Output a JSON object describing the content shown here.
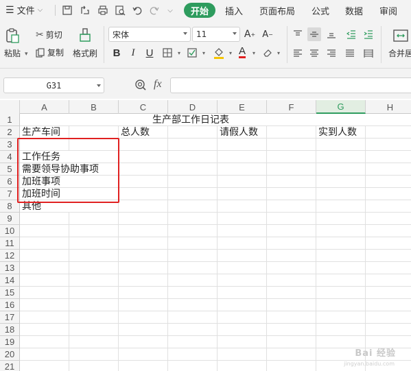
{
  "menubar": {
    "file_label": "文件",
    "tabs": [
      "开始",
      "插入",
      "页面布局",
      "公式",
      "数据",
      "审阅"
    ],
    "active_tab": "开始"
  },
  "ribbon": {
    "paste_label": "粘贴",
    "cut_label": "剪切",
    "copy_label": "复制",
    "format_painter_label": "格式刷",
    "font_name": "宋体",
    "font_size": "11",
    "merge_label": "合并居"
  },
  "formula_bar": {
    "name_box": "G31",
    "fx_label": "fx",
    "formula": ""
  },
  "grid": {
    "columns": [
      "A",
      "B",
      "C",
      "D",
      "E",
      "F",
      "G",
      "H"
    ],
    "selected_column": "G",
    "rows": [
      "1",
      "2",
      "3",
      "4",
      "5",
      "6",
      "7",
      "8",
      "9",
      "10",
      "11",
      "12",
      "13",
      "14",
      "15",
      "16",
      "17",
      "18",
      "19",
      "20",
      "21"
    ],
    "cells": {
      "title": "生产部工作日记表",
      "a2": "生产车间",
      "c2": "总人数",
      "e2": "请假人数",
      "g2": "实到人数",
      "a3": "工作任务",
      "a4": "需要领导协助事项",
      "a5": "加班事项",
      "a6": "加班时间",
      "a7": "其他"
    }
  },
  "watermark": {
    "text": "Bai 经验",
    "sub": "jingyan.baidu.com"
  },
  "colors": {
    "accent": "#2e9c5e",
    "highlight": "#e02020"
  }
}
